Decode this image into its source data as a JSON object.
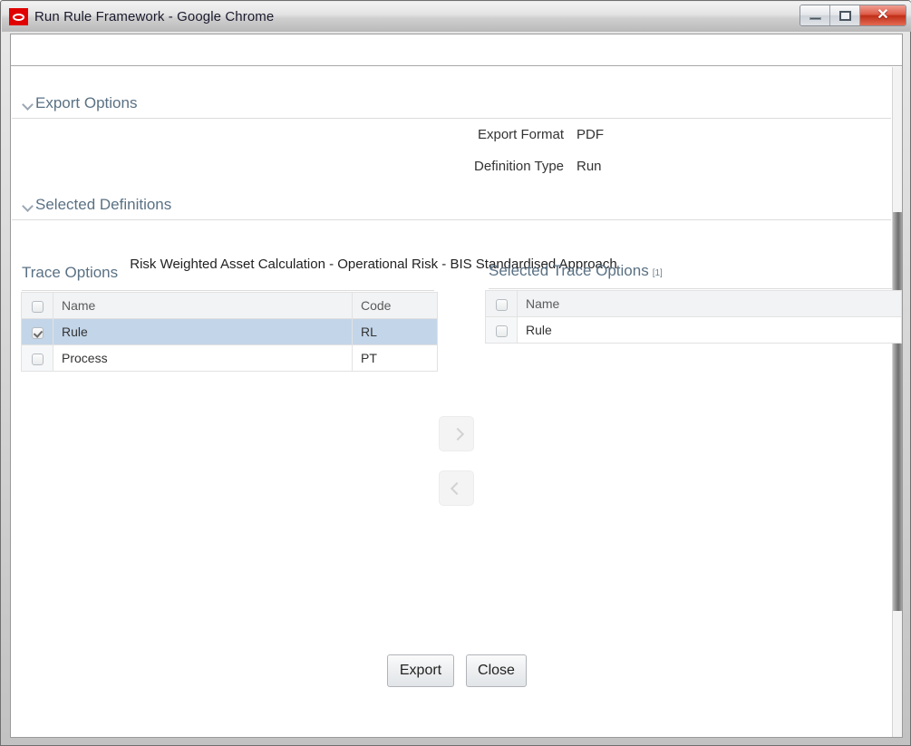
{
  "window": {
    "title": "Run Rule Framework - Google Chrome",
    "app_icon": "oracle-logo-icon",
    "controls": {
      "minimize": "minimize-icon",
      "maximize": "maximize-icon",
      "close": "✕"
    }
  },
  "export_options": {
    "header": "Export Options",
    "fields": [
      {
        "label": "Export Format",
        "value": "PDF"
      },
      {
        "label": "Definition Type",
        "value": "Run"
      }
    ]
  },
  "selected_definitions": {
    "header": "Selected Definitions",
    "name": "Risk Weighted Asset Calculation - Operational Risk - BIS Standardised Approach"
  },
  "trace_options": {
    "title": "Trace Options",
    "columns": [
      "Name",
      "Code"
    ],
    "rows": [
      {
        "name": "Rule",
        "code": "RL",
        "checked": true,
        "selected": true
      },
      {
        "name": "Process",
        "code": "PT",
        "checked": false,
        "selected": false
      }
    ]
  },
  "selected_trace_options": {
    "title": "Selected Trace Options",
    "count": "[1]",
    "columns": [
      "Name"
    ],
    "rows": [
      {
        "name": "Rule",
        "checked": false
      }
    ]
  },
  "transfer": {
    "add_label": "move-right",
    "remove_label": "move-left"
  },
  "footer": {
    "export_label": "Export",
    "close_label": "Close"
  },
  "scroll": {
    "up_arrow": "scroll-up-icon"
  },
  "colors": {
    "accent_header": "#5a7184",
    "row_selected": "#c3d5e8",
    "close_button": "#c02e16"
  }
}
